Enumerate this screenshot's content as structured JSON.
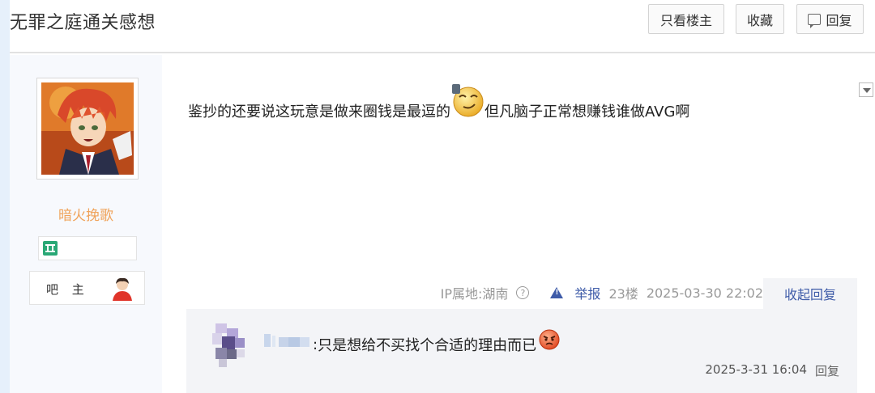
{
  "header": {
    "title": "无罪之庭通关感想",
    "only_op_label": "只看楼主",
    "collect_label": "收藏",
    "reply_label": "回复"
  },
  "author": {
    "name": "暗火挽歌",
    "role_label": "吧 主",
    "name_color": "#f0a35a"
  },
  "post": {
    "content_before": "鉴抄的还要说这玩意是做来圈钱是最逗的",
    "emoji_1": "smug-emoji",
    "content_after": "但凡脑子正常想赚钱谁做AVG啊",
    "ip_label": "IP属地:湖南",
    "report_label": "举报",
    "floor": "23楼",
    "datetime": "2025-03-30 22:02",
    "collapse_label": "收起回复"
  },
  "subreply": {
    "separator": ":",
    "text": "只是想给不买找个合适的理由而已",
    "emoji": "angry-emoji",
    "datetime": "2025-3-31 16:04",
    "reply_label": "回复"
  },
  "colors": {
    "accent_blue": "#3e5ba8",
    "page_strip": "#e6f0fb",
    "author_bg": "#f7f9fd",
    "subreply_bg": "#f3f4f7"
  }
}
